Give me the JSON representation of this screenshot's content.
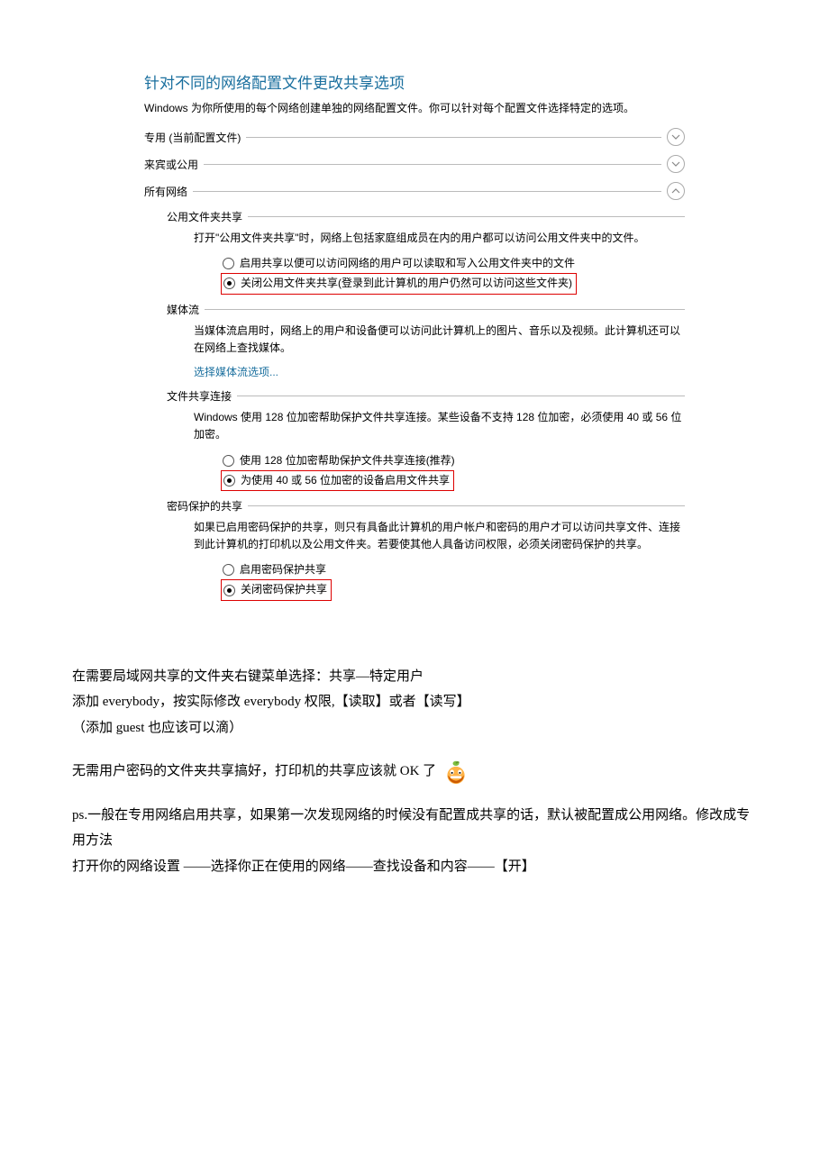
{
  "win": {
    "title": "针对不同的网络配置文件更改共享选项",
    "desc": "Windows 为你所使用的每个网络创建单独的网络配置文件。你可以针对每个配置文件选择特定的选项。",
    "profile_private": "专用 (当前配置文件)",
    "profile_guest": "来宾或公用",
    "profile_all": "所有网络"
  },
  "public_folder": {
    "title": "公用文件夹共享",
    "desc": "打开\"公用文件夹共享\"时，网络上包括家庭组成员在内的用户都可以访问公用文件夹中的文件。",
    "opt1": "启用共享以便可以访问网络的用户可以读取和写入公用文件夹中的文件",
    "opt2": "关闭公用文件夹共享(登录到此计算机的用户仍然可以访问这些文件夹)"
  },
  "media": {
    "title": "媒体流",
    "desc": "当媒体流启用时，网络上的用户和设备便可以访问此计算机上的图片、音乐以及视频。此计算机还可以在网络上查找媒体。",
    "link": "选择媒体流选项..."
  },
  "file_conn": {
    "title": "文件共享连接",
    "desc": "Windows 使用 128 位加密帮助保护文件共享连接。某些设备不支持 128 位加密，必须使用 40 或 56 位加密。",
    "opt1": "使用 128 位加密帮助保护文件共享连接(推荐)",
    "opt2": "为使用 40 或 56 位加密的设备启用文件共享"
  },
  "password": {
    "title": "密码保护的共享",
    "desc": "如果已启用密码保护的共享，则只有具备此计算机的用户帐户和密码的用户才可以访问共享文件、连接到此计算机的打印机以及公用文件夹。若要使其他人具备访问权限，必须关闭密码保护的共享。",
    "opt1": "启用密码保护共享",
    "opt2": "关闭密码保护共享"
  },
  "article": {
    "l1": "在需要局域网共享的文件夹右键菜单选择：共享—特定用户",
    "l2": "添加 everybody，按实际修改 everybody 权限,【读取】或者【读写】",
    "l3": "（添加 guest 也应该可以滴）",
    "l4": "无需用户密码的文件夹共享搞好，打印机的共享应该就 OK 了",
    "l5": "ps.一般在专用网络启用共享，如果第一次发现网络的时候没有配置成共享的话，默认被配置成公用网络。修改成专用方法",
    "l6": "打开你的网络设置 ——选择你正在使用的网络——查找设备和内容——【开】"
  }
}
